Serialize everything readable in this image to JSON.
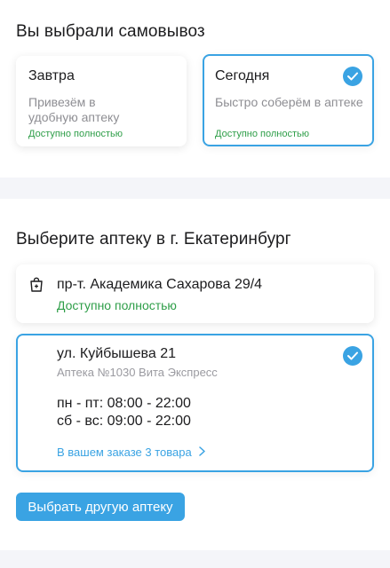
{
  "pickup": {
    "title": "Вы выбрали самовывоз",
    "options": [
      {
        "title": "Завтра",
        "desc_line1": "Привезём в",
        "desc_line2": "удобную аптеку",
        "availability": "Доступно полностью",
        "selected": false
      },
      {
        "title": "Сегодня",
        "desc_line1": "Быстро соберём в аптеке",
        "desc_line2": "",
        "availability": "Доступно полностью",
        "selected": true
      }
    ]
  },
  "pharmacy": {
    "title": "Выберите аптеку в г. Екатеринбург",
    "cards": [
      {
        "address": "пр-т. Академика Сахарова 29/4",
        "availability": "Доступно полностью",
        "icon": "bag-icon"
      },
      {
        "address": "ул. Куйбышева 21",
        "name": "Аптека №1030 Вита Экспресс",
        "hours_weekdays": "пн - пт: 08:00 - 22:00",
        "hours_weekend": "сб - вс: 09:00 - 22:00",
        "order_link": "В вашем заказе 3 товара",
        "selected": true
      }
    ],
    "choose_other_button": "Выбрать другую аптеку"
  },
  "colors": {
    "accent": "#3aa3e3",
    "success": "#2e9e48",
    "muted": "#8e8e93",
    "band": "#f4f5f9"
  }
}
